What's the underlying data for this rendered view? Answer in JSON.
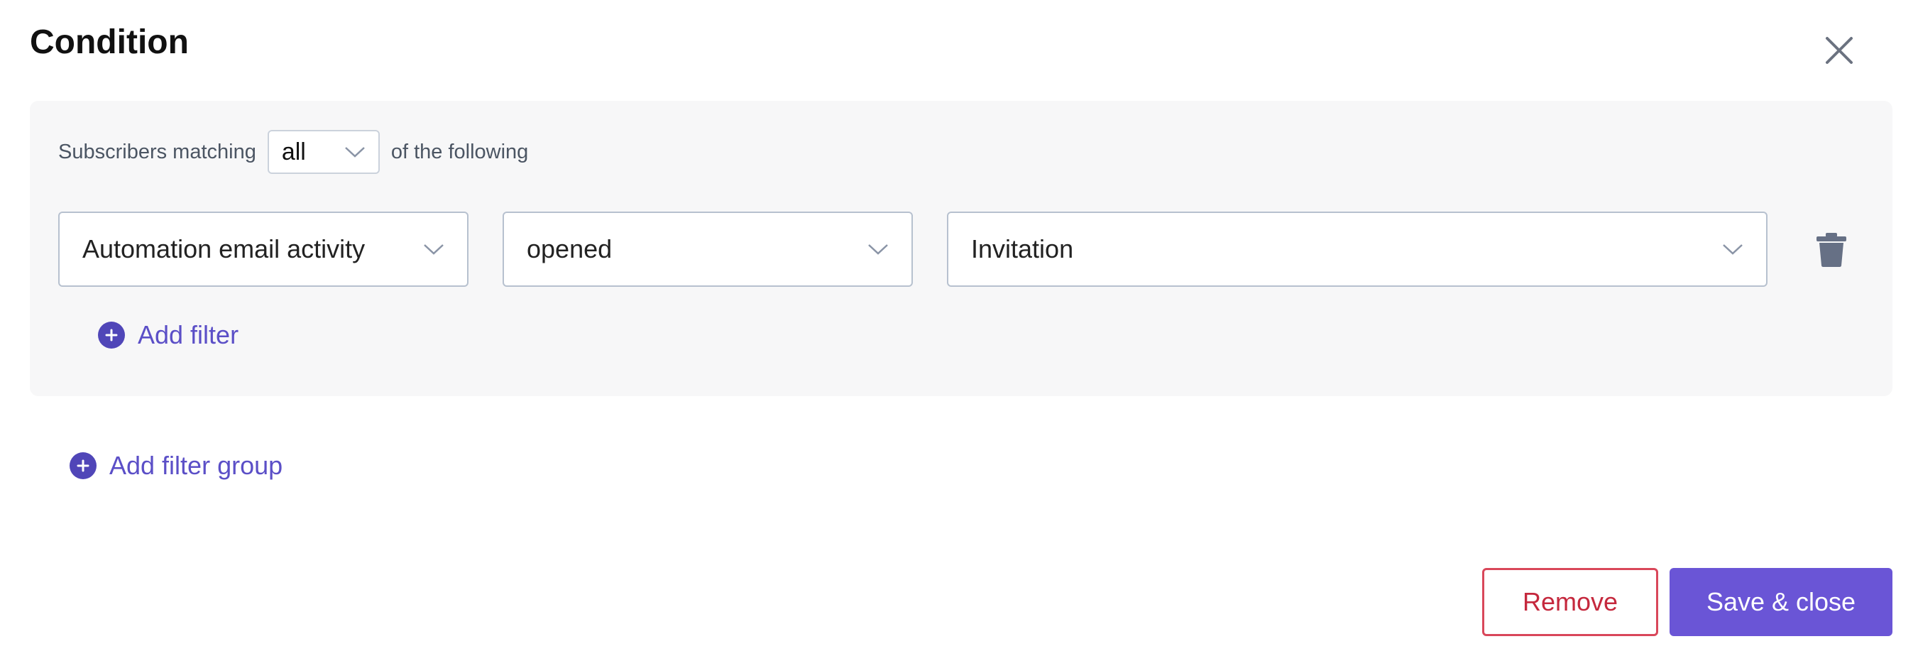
{
  "dialog": {
    "title": "Condition",
    "close_icon": "close-icon"
  },
  "matching": {
    "prefix": "Subscribers matching",
    "selected": "all",
    "suffix": "of the following"
  },
  "filter": {
    "field": "Automation email activity",
    "operator": "opened",
    "value": "Invitation",
    "delete_icon": "trash-icon"
  },
  "actions": {
    "add_filter": "Add filter",
    "add_filter_group": "Add filter group",
    "remove": "Remove",
    "save_close": "Save & close"
  },
  "colors": {
    "accent": "#6a55d6",
    "link": "#5b4fc7",
    "danger": "#c5283d",
    "panel_bg": "#f7f7f8"
  }
}
